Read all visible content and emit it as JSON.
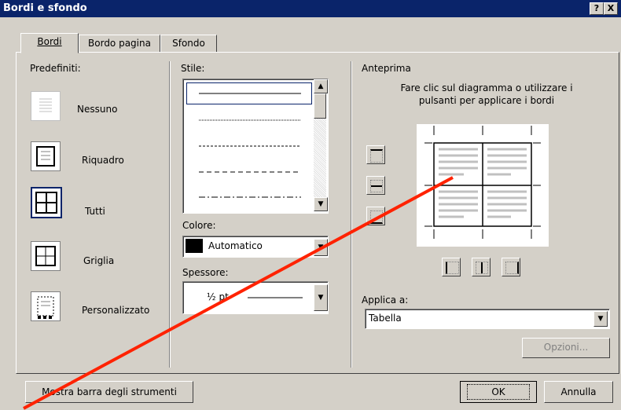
{
  "window": {
    "title": "Bordi e sfondo",
    "help_label": "?",
    "close_label": "X"
  },
  "tabs": [
    {
      "label": "Bordi",
      "mnemonic": "B"
    },
    {
      "label": "Bordo pagina",
      "mnemonic": "r"
    },
    {
      "label": "Sfondo",
      "mnemonic": "S"
    }
  ],
  "presets": {
    "heading": "Predefiniti:",
    "items": [
      {
        "label": "Nessuno"
      },
      {
        "label": "Riquadro"
      },
      {
        "label": "Tutti"
      },
      {
        "label": "Griglia"
      },
      {
        "label": "Personalizzato"
      }
    ]
  },
  "style": {
    "heading": "Stile:",
    "line_styles": [
      "solid",
      "dotted",
      "dashed-fine",
      "dashed",
      "dash-dot"
    ]
  },
  "color": {
    "heading": "Colore:",
    "value": "Automatico",
    "swatch": "#000000"
  },
  "width": {
    "heading": "Spessore:",
    "value": "½ pt"
  },
  "preview": {
    "heading": "Anteprima",
    "instructions_line1": "Fare clic sul diagramma o utilizzare i",
    "instructions_line2": "pulsanti per applicare i bordi"
  },
  "apply": {
    "heading": "Applica a:",
    "value": "Tabella"
  },
  "buttons": {
    "options": "Opzioni...",
    "toolbar": "Mostra barra degli strumenti",
    "ok": "OK",
    "cancel": "Annulla"
  },
  "annotation": {
    "arrow_color": "#ff2200"
  }
}
